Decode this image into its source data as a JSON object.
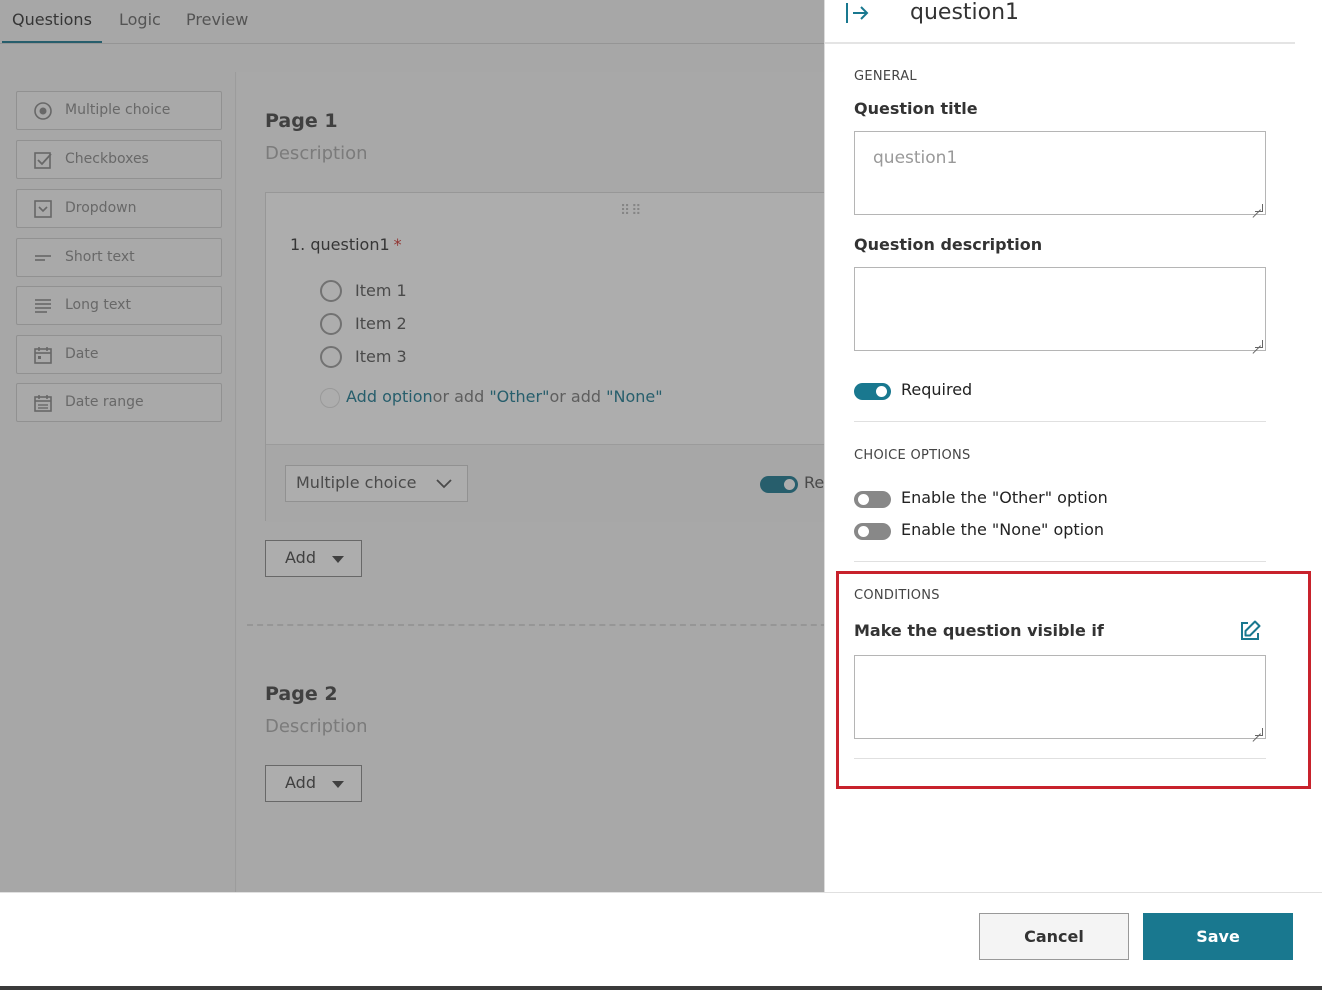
{
  "tabs": [
    {
      "label": "Questions",
      "active": true
    },
    {
      "label": "Logic",
      "active": false
    },
    {
      "label": "Preview",
      "active": false
    }
  ],
  "toolbox": [
    {
      "label": "Multiple choice",
      "icon": "radio-icon"
    },
    {
      "label": "Checkboxes",
      "icon": "checkbox-icon"
    },
    {
      "label": "Dropdown",
      "icon": "dropdown-icon"
    },
    {
      "label": "Short text",
      "icon": "short-text-icon"
    },
    {
      "label": "Long text",
      "icon": "long-text-icon"
    },
    {
      "label": "Date",
      "icon": "calendar-icon"
    },
    {
      "label": "Date range",
      "icon": "calendar-range-icon"
    }
  ],
  "canvas": {
    "page1": {
      "title": "Page 1",
      "description": "Description"
    },
    "page2": {
      "title": "Page 2",
      "description": "Description"
    },
    "question": {
      "number": "1.",
      "title": "question1",
      "required_mark": "*",
      "items": [
        "Item 1",
        "Item 2",
        "Item 3"
      ],
      "add_option": "Add option",
      "or_add_1": "or add ",
      "other_link": "\"Other\"",
      "or_add_2": "or add ",
      "none_link": "\"None\"",
      "type_select": "Multiple choice",
      "required_short": "Re"
    },
    "add_label": "Add"
  },
  "panel": {
    "title": "question1",
    "general_heading": "GENERAL",
    "question_title_label": "Question title",
    "question_title_placeholder": "question1",
    "question_description_label": "Question description",
    "required_label": "Required",
    "required_on": true,
    "choice_heading": "CHOICE OPTIONS",
    "other_option_label": "Enable the \"Other\" option",
    "other_option_on": false,
    "none_option_label": "Enable the \"None\" option",
    "none_option_on": false,
    "conditions_heading": "CONDITIONS",
    "visible_if_label": "Make the question visible if"
  },
  "footer": {
    "cancel_label": "Cancel",
    "save_label": "Save"
  },
  "colors": {
    "accent": "#19788f",
    "highlight": "#c8222c",
    "required": "#d0312d"
  }
}
